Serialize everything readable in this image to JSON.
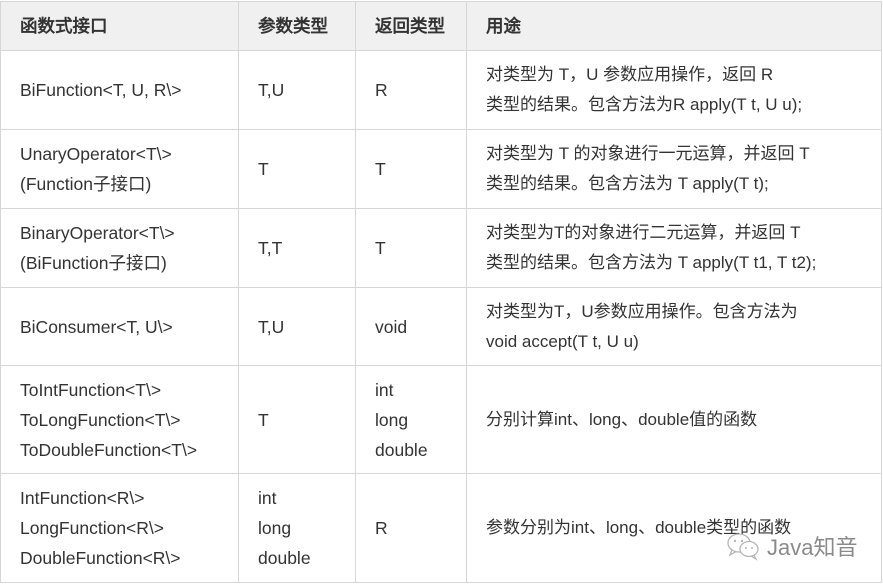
{
  "table": {
    "headers": [
      "函数式接口",
      "参数类型",
      "返回类型",
      "用途"
    ],
    "rows": [
      {
        "interface": [
          "BiFunction<T, U, R\\>"
        ],
        "params": [
          "T,U"
        ],
        "returns": [
          "R"
        ],
        "usage": [
          "对类型为 T，U 参数应用操作，返回 R",
          "类型的结果。包含方法为R apply(T t, U u);"
        ]
      },
      {
        "interface": [
          "UnaryOperator<T\\>",
          "(Function子接口)"
        ],
        "params": [
          "T"
        ],
        "returns": [
          "T"
        ],
        "usage": [
          "对类型为 T 的对象进行一元运算，并返回 T",
          "类型的结果。包含方法为 T apply(T t);"
        ]
      },
      {
        "interface": [
          "BinaryOperator<T\\>",
          "(BiFunction子接口)"
        ],
        "params": [
          "T,T"
        ],
        "returns": [
          "T"
        ],
        "usage": [
          "对类型为T的对象进行二元运算，并返回 T",
          "类型的结果。包含方法为 T apply(T t1, T t2);"
        ]
      },
      {
        "interface": [
          "BiConsumer<T, U\\>"
        ],
        "params": [
          "T,U"
        ],
        "returns": [
          "void"
        ],
        "usage": [
          "对类型为T，U参数应用操作。包含方法为",
          "void accept(T t, U u)"
        ]
      },
      {
        "interface": [
          "ToIntFunction<T\\>",
          "ToLongFunction<T\\>",
          "ToDoubleFunction<T\\>"
        ],
        "params": [
          "T"
        ],
        "returns": [
          "int",
          "long",
          "double"
        ],
        "usage": [
          "分别计算int、long、double值的函数"
        ]
      },
      {
        "interface": [
          "IntFunction<R\\>",
          "LongFunction<R\\>",
          "DoubleFunction<R\\>"
        ],
        "params": [
          "int",
          "long",
          "double"
        ],
        "returns": [
          "R"
        ],
        "usage": [
          "参数分别为int、long、double类型的函数"
        ]
      }
    ]
  },
  "watermark": {
    "icon": "wechat-icon",
    "text": "Java知音"
  },
  "colors": {
    "header_bg": "#f0f0f0",
    "border": "#d6d6d6",
    "text": "#333333"
  }
}
